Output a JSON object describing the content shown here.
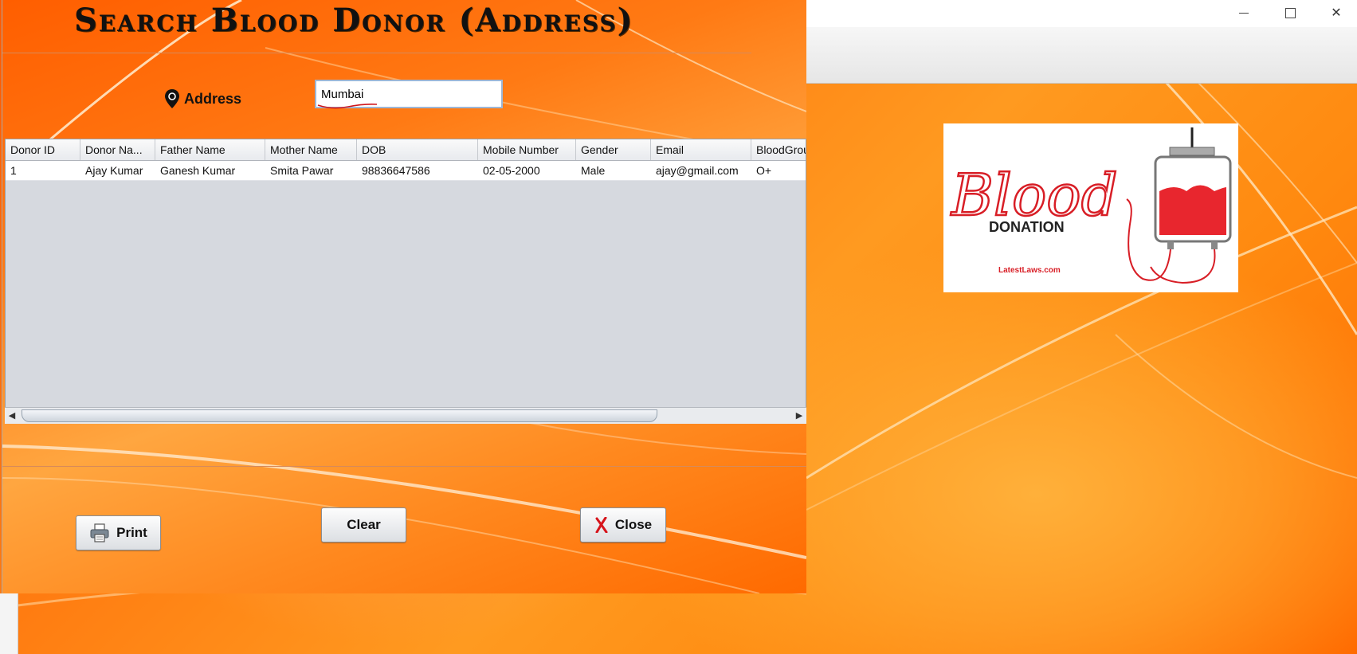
{
  "window": {
    "title": "Search Blood Donor (Address)",
    "minimize_label": "minimize",
    "maximize_label": "maximize",
    "close_label": "close"
  },
  "search": {
    "label": "Address",
    "value": "Mumbai",
    "icon": "location-pin-icon"
  },
  "table": {
    "columns": [
      "Donor ID",
      "Donor Na...",
      "Father Name",
      "Mother Name",
      "DOB",
      "Mobile Number",
      "Gender",
      "Email",
      "BloodGrou"
    ],
    "rows": [
      [
        "1",
        "Ajay Kumar",
        "Ganesh Kumar",
        "Smita Pawar",
        "98836647586",
        "02-05-2000",
        "Male",
        "ajay@gmail.com",
        "O+"
      ]
    ]
  },
  "buttons": {
    "print": "Print",
    "clear": "Clear",
    "close": "Close"
  },
  "logo": {
    "word": "Blood",
    "subtitle": "DONATION",
    "site": "LatestLaws.com"
  },
  "colors": {
    "accent": "#ff7a10",
    "blood_red": "#e8262e"
  }
}
